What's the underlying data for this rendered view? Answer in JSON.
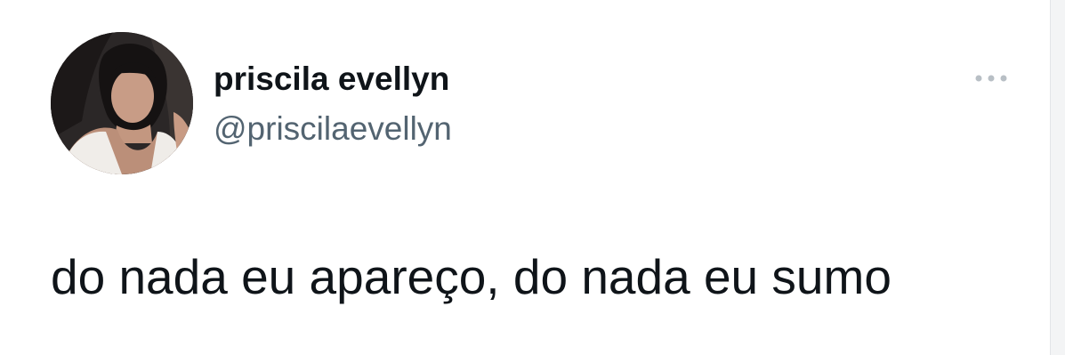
{
  "tweet": {
    "author": {
      "display_name": "priscila evellyn",
      "handle": "@priscilaevellyn",
      "avatar_icon": "profile-photo"
    },
    "more_icon": "more-horizontal-icon",
    "text": "do nada eu apareço, do nada eu sumo"
  },
  "colors": {
    "name": "#0f1419",
    "handle": "#536471",
    "more_dots": "#b8bfc5",
    "background": "#ffffff"
  }
}
